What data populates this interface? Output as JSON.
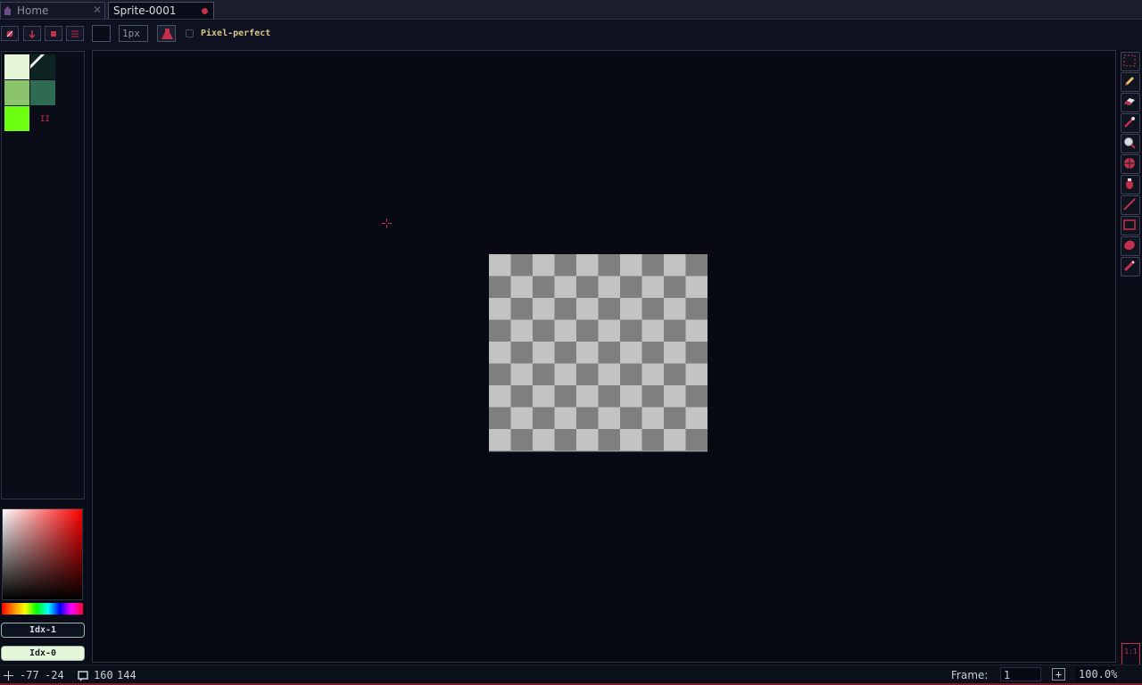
{
  "tabs": [
    {
      "label": "Home",
      "close": "✕"
    },
    {
      "label": "Sprite-0001"
    }
  ],
  "toolbar": {
    "brush_size": "1px",
    "pixel_perfect_label": "Pixel-perfect",
    "pixel_perfect_checked": false
  },
  "palette": {
    "colors": [
      "#e6f7d9",
      "#0e2422",
      "#8cc46e",
      "#2f6a52",
      "#6cff10"
    ],
    "marker": "II"
  },
  "color_indices": {
    "foreground": "Idx-1",
    "background": "Idx-0"
  },
  "status": {
    "cursor_x": "-77",
    "cursor_y": "-24",
    "sprite_w": "160",
    "sprite_h": "144",
    "frame_label": "Frame:",
    "frame_value": "1",
    "add_frame": "+",
    "zoom": "100.0%"
  },
  "toolbox": {
    "tools": [
      "marquee-tool",
      "pencil-tool",
      "eraser-tool",
      "eyedropper-tool",
      "zoom-tool",
      "move-tool",
      "paint-bucket-tool",
      "line-tool",
      "rectangle-tool",
      "ellipse-tool",
      "contour-tool"
    ],
    "one_to_one": "1:1"
  },
  "colors": {
    "accent": "#c2304c",
    "background": "#0a0d17",
    "checker_dark": "#7f7f7f",
    "checker_light": "#c3c3c3"
  }
}
